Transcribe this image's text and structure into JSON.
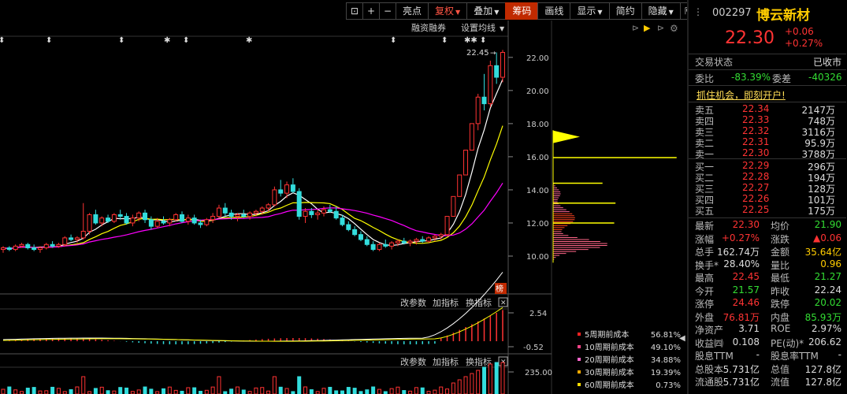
{
  "toolbar": {
    "items": [
      "亮点",
      "复权",
      "叠加",
      "筹码",
      "画线",
      "显示",
      "简约",
      "隐藏"
    ],
    "active": "筹码"
  },
  "chart": {
    "menu_left": "融资融券",
    "menu_right": "设置均线",
    "high_label": "22.45",
    "price_ticks": [
      "22.00",
      "20.00",
      "18.00",
      "16.00",
      "14.00",
      "12.00",
      "10.00"
    ],
    "badge": "榜",
    "sub1": {
      "btn1": "改参数",
      "btn2": "加指标",
      "btn3": "换指标",
      "ticks": [
        "2.54",
        "-0.52"
      ]
    },
    "sub2": {
      "btn1": "改参数",
      "btn2": "加指标",
      "btn3": "换指标",
      "ticks": [
        "235.00"
      ]
    },
    "cost_legend": [
      {
        "label": "5周期前成本",
        "value": "56.81%",
        "color": "#ff2222"
      },
      {
        "label": "10周期前成本",
        "value": "49.10%",
        "color": "#ff4488"
      },
      {
        "label": "20周期前成本",
        "value": "34.88%",
        "color": "#ff66cc"
      },
      {
        "label": "30周期前成本",
        "value": "19.39%",
        "color": "#ffaa00"
      },
      {
        "label": "60周期前成本",
        "value": "0.73%",
        "color": "#ffdd00"
      }
    ]
  },
  "quote": {
    "code": "002297",
    "name": "博云新材",
    "price": "22.30",
    "change": "+0.06",
    "change_pct": "+0.27%",
    "status_label": "交易状态",
    "status_value": "已收市",
    "weibi_label": "委比",
    "weibi_value": "-83.39%",
    "weicha_label": "委差",
    "weicha_value": "-40326",
    "promo": "抓住机会，即刻开户!",
    "asks": [
      {
        "label": "卖五",
        "price": "22.34",
        "vol": "2147万"
      },
      {
        "label": "卖四",
        "price": "22.33",
        "vol": "748万"
      },
      {
        "label": "卖三",
        "price": "22.32",
        "vol": "3116万"
      },
      {
        "label": "卖二",
        "price": "22.31",
        "vol": "95.9万"
      },
      {
        "label": "卖一",
        "price": "22.30",
        "vol": "3788万"
      }
    ],
    "bids": [
      {
        "label": "买一",
        "price": "22.29",
        "vol": "296万"
      },
      {
        "label": "买二",
        "price": "22.28",
        "vol": "194万"
      },
      {
        "label": "买三",
        "price": "22.27",
        "vol": "128万"
      },
      {
        "label": "买四",
        "price": "22.26",
        "vol": "101万"
      },
      {
        "label": "买五",
        "price": "22.25",
        "vol": "175万"
      }
    ],
    "stats": [
      {
        "l1": "最新",
        "v1": "22.30",
        "c1": "red",
        "l2": "均价",
        "v2": "21.90",
        "c2": "green"
      },
      {
        "l1": "涨幅",
        "v1": "+0.27%",
        "c1": "red",
        "l2": "涨跌",
        "v2": "▲0.06",
        "c2": "red"
      },
      {
        "l1": "总手",
        "v1": "162.74万",
        "c1": "white",
        "l2": "金额",
        "v2": "35.64亿",
        "c2": "yellow"
      },
      {
        "l1": "换手*",
        "v1": "28.40%",
        "c1": "white",
        "l2": "量比",
        "v2": "0.96",
        "c2": "yellow"
      },
      {
        "l1": "最高",
        "v1": "22.45",
        "c1": "red",
        "l2": "最低",
        "v2": "21.27",
        "c2": "green"
      },
      {
        "l1": "今开",
        "v1": "21.57",
        "c1": "green",
        "l2": "昨收",
        "v2": "22.24",
        "c2": "white"
      },
      {
        "l1": "涨停",
        "v1": "24.46",
        "c1": "red",
        "l2": "跌停",
        "v2": "20.02",
        "c2": "green"
      },
      {
        "l1": "外盘",
        "v1": "76.81万",
        "c1": "red",
        "l2": "内盘",
        "v2": "85.93万",
        "c2": "green"
      },
      {
        "l1": "净资产",
        "v1": "3.71",
        "c1": "white",
        "l2": "ROE",
        "v2": "2.97%",
        "c2": "white"
      },
      {
        "l1": "收益㈣",
        "v1": "0.108",
        "c1": "white",
        "l2": "PE(动)*",
        "v2": "206.62",
        "c2": "white"
      },
      {
        "l1": "股息TTM",
        "v1": "-",
        "c1": "white",
        "l2": "股息率TTM",
        "v2": "-",
        "c2": "white"
      },
      {
        "l1": "总股本",
        "v1": "5.731亿",
        "c1": "white",
        "l2": "总值",
        "v2": "127.8亿",
        "c2": "white"
      },
      {
        "l1": "流通股",
        "v1": "5.731亿",
        "c1": "white",
        "l2": "流值",
        "v2": "127.8亿",
        "c2": "white"
      }
    ]
  },
  "chart_data": {
    "type": "candlestick",
    "ylim": [
      9.0,
      22.8
    ],
    "candles": [
      [
        10.4,
        10.6,
        10.2,
        10.5
      ],
      [
        10.5,
        10.6,
        10.3,
        10.4
      ],
      [
        10.4,
        10.7,
        10.3,
        10.6
      ],
      [
        10.6,
        10.8,
        10.5,
        10.7
      ],
      [
        10.7,
        10.8,
        10.4,
        10.5
      ],
      [
        10.5,
        10.7,
        10.3,
        10.4
      ],
      [
        10.4,
        10.6,
        10.2,
        10.5
      ],
      [
        10.5,
        10.8,
        10.4,
        10.7
      ],
      [
        10.7,
        10.9,
        10.5,
        10.6
      ],
      [
        10.6,
        10.8,
        10.5,
        10.7
      ],
      [
        10.7,
        11.2,
        10.6,
        11.1
      ],
      [
        11.1,
        11.3,
        10.9,
        11.0
      ],
      [
        11.0,
        11.2,
        10.8,
        11.1
      ],
      [
        11.1,
        13.2,
        11.0,
        11.5
      ],
      [
        11.5,
        12.6,
        11.3,
        12.5
      ],
      [
        12.5,
        12.8,
        11.9,
        12.0
      ],
      [
        12.0,
        12.4,
        11.8,
        12.3
      ],
      [
        12.3,
        12.5,
        12.0,
        12.1
      ],
      [
        12.1,
        12.6,
        12.0,
        12.5
      ],
      [
        12.5,
        12.8,
        12.2,
        12.4
      ],
      [
        12.4,
        12.6,
        11.9,
        12.0
      ],
      [
        12.0,
        12.5,
        11.8,
        12.3
      ],
      [
        12.3,
        12.7,
        12.1,
        12.6
      ],
      [
        12.6,
        12.8,
        12.0,
        12.2
      ],
      [
        12.2,
        12.4,
        11.6,
        11.8
      ],
      [
        11.8,
        12.3,
        11.7,
        12.1
      ],
      [
        12.1,
        12.4,
        11.9,
        12.0
      ],
      [
        12.0,
        12.3,
        11.8,
        12.2
      ],
      [
        12.2,
        12.6,
        12.1,
        12.5
      ],
      [
        12.5,
        12.7,
        12.0,
        12.1
      ],
      [
        12.1,
        12.5,
        11.9,
        12.3
      ],
      [
        12.3,
        12.5,
        11.9,
        12.0
      ],
      [
        12.0,
        12.2,
        11.7,
        11.9
      ],
      [
        11.9,
        12.3,
        11.8,
        12.2
      ],
      [
        12.2,
        12.6,
        12.0,
        12.4
      ],
      [
        12.4,
        13.1,
        12.3,
        12.9
      ],
      [
        12.9,
        13.2,
        12.4,
        12.6
      ],
      [
        12.6,
        12.8,
        12.2,
        12.4
      ],
      [
        12.4,
        12.6,
        12.1,
        12.5
      ],
      [
        12.5,
        12.8,
        12.3,
        12.4
      ],
      [
        12.4,
        12.7,
        12.2,
        12.6
      ],
      [
        12.6,
        12.8,
        12.4,
        12.7
      ],
      [
        12.7,
        13.0,
        12.5,
        12.9
      ],
      [
        12.9,
        13.2,
        12.7,
        13.1
      ],
      [
        13.1,
        14.2,
        13.0,
        14.0
      ],
      [
        14.0,
        14.6,
        13.6,
        13.8
      ],
      [
        13.8,
        14.5,
        13.5,
        14.3
      ],
      [
        14.3,
        14.7,
        13.8,
        13.9
      ],
      [
        13.9,
        14.1,
        12.2,
        12.4
      ],
      [
        12.4,
        12.9,
        12.0,
        12.7
      ],
      [
        12.7,
        12.9,
        12.3,
        12.5
      ],
      [
        12.5,
        12.8,
        12.2,
        12.6
      ],
      [
        12.6,
        13.0,
        12.4,
        12.8
      ],
      [
        12.8,
        13.1,
        12.6,
        12.7
      ],
      [
        12.7,
        13.0,
        12.2,
        12.3
      ],
      [
        12.3,
        12.5,
        11.8,
        11.9
      ],
      [
        11.9,
        12.1,
        11.5,
        11.6
      ],
      [
        11.6,
        11.8,
        11.2,
        11.3
      ],
      [
        11.3,
        11.5,
        10.9,
        11.0
      ],
      [
        11.0,
        11.2,
        10.6,
        10.7
      ],
      [
        10.7,
        10.9,
        10.3,
        10.4
      ],
      [
        10.4,
        10.8,
        10.3,
        10.7
      ],
      [
        10.7,
        11.0,
        10.5,
        10.6
      ],
      [
        10.6,
        10.9,
        10.4,
        10.8
      ],
      [
        10.8,
        11.0,
        10.6,
        10.9
      ],
      [
        10.9,
        11.1,
        10.7,
        10.8
      ],
      [
        10.8,
        11.0,
        10.6,
        10.9
      ],
      [
        10.9,
        11.1,
        10.7,
        11.0
      ],
      [
        11.0,
        11.2,
        10.8,
        10.9
      ],
      [
        10.9,
        11.2,
        10.8,
        11.1
      ],
      [
        11.1,
        11.3,
        10.9,
        11.2
      ],
      [
        11.2,
        11.4,
        11.0,
        11.3
      ],
      [
        11.3,
        12.4,
        11.2,
        12.4
      ],
      [
        12.4,
        13.6,
        12.4,
        13.6
      ],
      [
        13.6,
        14.9,
        13.6,
        14.9
      ],
      [
        14.9,
        16.4,
        14.9,
        16.4
      ],
      [
        16.4,
        18.0,
        16.4,
        18.0
      ],
      [
        18.0,
        19.8,
        17.6,
        19.6
      ],
      [
        19.6,
        21.0,
        18.8,
        19.2
      ],
      [
        19.2,
        21.8,
        19.0,
        21.5
      ],
      [
        21.5,
        22.3,
        20.4,
        20.8
      ],
      [
        20.8,
        22.45,
        20.5,
        22.3
      ]
    ],
    "ma": [
      {
        "name": "MA5",
        "color": "#ffffff"
      },
      {
        "name": "MA10",
        "color": "#ffff00"
      },
      {
        "name": "MA20",
        "color": "#ff00ff"
      }
    ],
    "profile": [
      {
        "price": 17.2,
        "width": 0.16,
        "color": "#ffff00"
      },
      {
        "price": 15.95,
        "width": 0.95,
        "color": "#ffff00"
      },
      {
        "price": 14.4,
        "width": 0.38,
        "color": "#ffff00"
      },
      {
        "price": 13.2,
        "width": 0.48,
        "color": "#ffff00"
      },
      {
        "price": 12.0,
        "width": 0.47,
        "color": "#ffff00"
      }
    ]
  }
}
